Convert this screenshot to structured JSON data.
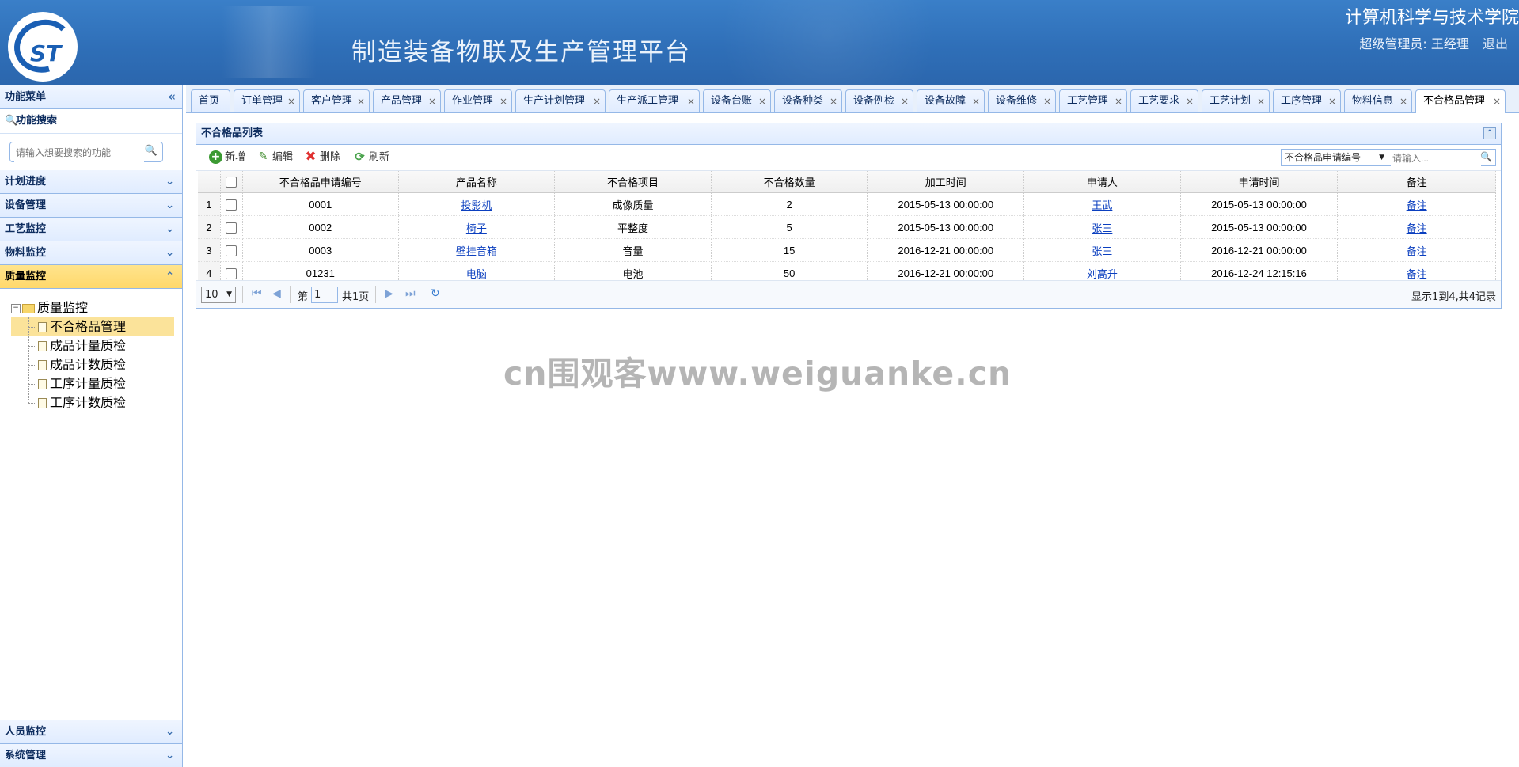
{
  "header": {
    "app_title": "制造装备物联及生产管理平台",
    "school_name": "计算机科学与技术学院",
    "user_role_label": "超级管理员: 王经理",
    "logout_label": "退出"
  },
  "sidebar": {
    "title": "功能菜单",
    "search_title": "功能搜索",
    "search_placeholder": "请输入想要搜索的功能",
    "sections": [
      "计划进度",
      "设备管理",
      "工艺监控",
      "物料监控",
      "质量监控"
    ],
    "tree": {
      "root": "质量监控",
      "children": [
        "不合格品管理",
        "成品计量质检",
        "成品计数质检",
        "工序计量质检",
        "工序计数质检"
      ]
    },
    "bottom_sections": [
      "人员监控",
      "系统管理"
    ]
  },
  "tabs": [
    "首页",
    "订单管理",
    "客户管理",
    "产品管理",
    "作业管理",
    "生产计划管理",
    "生产派工管理",
    "设备台账",
    "设备种类",
    "设备例检",
    "设备故障",
    "设备维修",
    "工艺管理",
    "工艺要求",
    "工艺计划",
    "工序管理",
    "物料信息",
    "不合格品管理"
  ],
  "grid": {
    "title": "不合格品列表",
    "toolbar": {
      "add": "新增",
      "edit": "编辑",
      "delete": "删除",
      "refresh": "刷新"
    },
    "search_field": "不合格品申请编号",
    "search_placeholder": "请输入...",
    "columns": [
      "不合格品申请编号",
      "产品名称",
      "不合格项目",
      "不合格数量",
      "加工时间",
      "申请人",
      "申请时间",
      "备注"
    ],
    "rows": [
      [
        "0001",
        "投影机",
        "成像质量",
        "2",
        "2015-05-13 00:00:00",
        "王武",
        "2015-05-13 00:00:00",
        "备注"
      ],
      [
        "0002",
        "椅子",
        "平整度",
        "5",
        "2015-05-13 00:00:00",
        "张三",
        "2015-05-13 00:00:00",
        "备注"
      ],
      [
        "0003",
        "壁挂音箱",
        "音量",
        "15",
        "2016-12-21 00:00:00",
        "张三",
        "2016-12-21 00:00:00",
        "备注"
      ],
      [
        "01231",
        "电脑",
        "电池",
        "50",
        "2016-12-21 00:00:00",
        "刘高升",
        "2016-12-24 12:15:16",
        "备注"
      ]
    ],
    "pager": {
      "page_size": "10",
      "page_prefix": "第",
      "page_value": "1",
      "page_total": "共1页",
      "info": "显示1到4,共4记录"
    }
  },
  "watermark": "cn围观客www.weiguanke.cn"
}
